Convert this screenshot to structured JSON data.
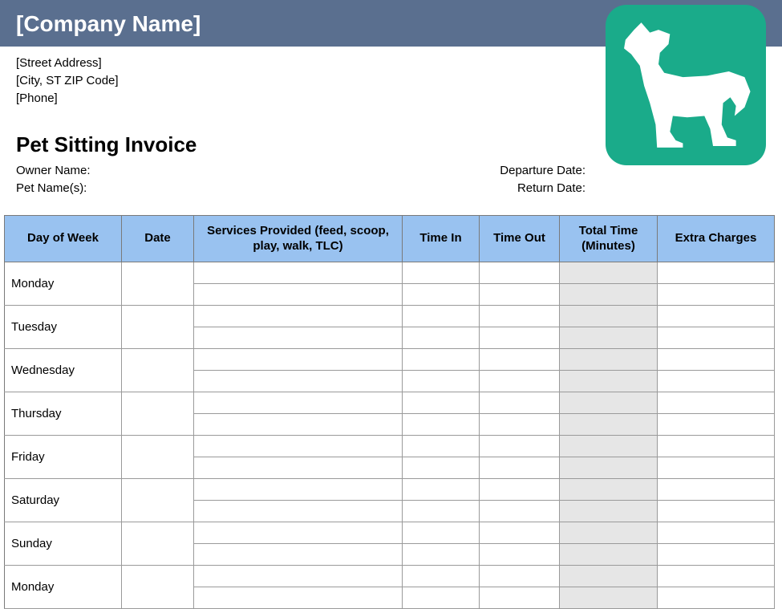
{
  "header": {
    "company_name": "[Company Name]",
    "street": "[Street Address]",
    "city_line": "[City, ST  ZIP Code]",
    "phone": "[Phone]"
  },
  "document": {
    "title": "Pet Sitting Invoice",
    "owner_label": "Owner Name:",
    "pet_label": "Pet Name(s):",
    "departure_label": "Departure Date:",
    "return_label": "Return Date:"
  },
  "columns": {
    "day": "Day of Week",
    "date": "Date",
    "services": "Services Provided (feed, scoop, play, walk, TLC)",
    "time_in": "Time In",
    "time_out": "Time Out",
    "total_time": "Total Time (Minutes)",
    "extra": "Extra Charges"
  },
  "rows": [
    {
      "day": "Monday"
    },
    {
      "day": "Tuesday"
    },
    {
      "day": "Wednesday"
    },
    {
      "day": "Thursday"
    },
    {
      "day": "Friday"
    },
    {
      "day": "Saturday"
    },
    {
      "day": "Sunday"
    },
    {
      "day": "Monday"
    }
  ],
  "icon": {
    "name": "dog-icon"
  }
}
